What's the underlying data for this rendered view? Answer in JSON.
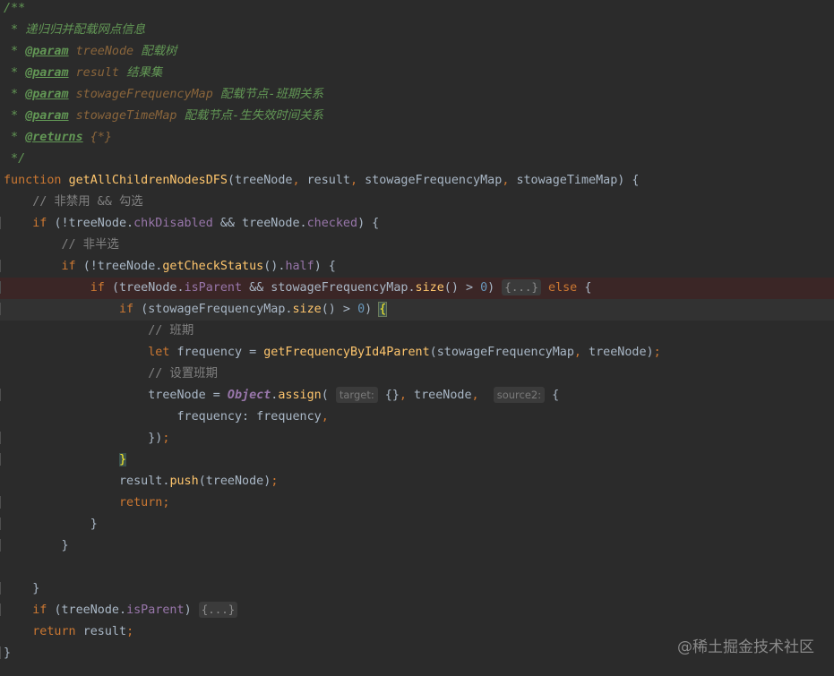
{
  "editor": {
    "lines": [
      {
        "segments": [
          {
            "t": "/**",
            "c": "doc"
          }
        ]
      },
      {
        "segments": [
          {
            "t": " * 递归归并配载网点信息",
            "c": "doc"
          }
        ]
      },
      {
        "segments": [
          {
            "t": " * ",
            "c": "doc"
          },
          {
            "t": "@param",
            "c": "doc-tag"
          },
          {
            "t": " treeNode ",
            "c": "doc-val"
          },
          {
            "t": "配载树",
            "c": "doc"
          }
        ]
      },
      {
        "segments": [
          {
            "t": " * ",
            "c": "doc"
          },
          {
            "t": "@param",
            "c": "doc-tag"
          },
          {
            "t": " result ",
            "c": "doc-val"
          },
          {
            "t": "结果集",
            "c": "doc"
          }
        ]
      },
      {
        "segments": [
          {
            "t": " * ",
            "c": "doc"
          },
          {
            "t": "@param",
            "c": "doc-tag"
          },
          {
            "t": " stowageFrequencyMap ",
            "c": "doc-val"
          },
          {
            "t": "配载节点-班期关系",
            "c": "doc"
          }
        ]
      },
      {
        "segments": [
          {
            "t": " * ",
            "c": "doc"
          },
          {
            "t": "@param",
            "c": "doc-tag"
          },
          {
            "t": " stowageTimeMap ",
            "c": "doc-val"
          },
          {
            "t": "配载节点-生失效时间关系",
            "c": "doc"
          }
        ]
      },
      {
        "segments": [
          {
            "t": " * ",
            "c": "doc"
          },
          {
            "t": "@returns",
            "c": "doc-tag"
          },
          {
            "t": " {*}",
            "c": "doc-val"
          }
        ]
      },
      {
        "segments": [
          {
            "t": " */",
            "c": "doc"
          }
        ]
      },
      {
        "segments": [
          {
            "t": "function ",
            "c": "kw"
          },
          {
            "t": "getAllChildrenNodesDFS",
            "c": "fn"
          },
          {
            "t": "(treeNode",
            "c": "plain"
          },
          {
            "t": ", ",
            "c": "kw"
          },
          {
            "t": "result",
            "c": "plain"
          },
          {
            "t": ", ",
            "c": "kw"
          },
          {
            "t": "stowageFrequencyMap",
            "c": "plain"
          },
          {
            "t": ", ",
            "c": "kw"
          },
          {
            "t": "stowageTimeMap) {",
            "c": "plain"
          }
        ]
      },
      {
        "segments": [
          {
            "t": "    // 非禁用 && 勾选",
            "c": "cmt"
          }
        ]
      },
      {
        "segments": [
          {
            "t": "    if ",
            "c": "kw"
          },
          {
            "t": "(!treeNode.",
            "c": "plain"
          },
          {
            "t": "chkDisabled",
            "c": "field"
          },
          {
            "t": " && treeNode.",
            "c": "plain"
          },
          {
            "t": "checked",
            "c": "field"
          },
          {
            "t": ") {",
            "c": "plain"
          }
        ]
      },
      {
        "segments": [
          {
            "t": "        // 非半选",
            "c": "cmt"
          }
        ]
      },
      {
        "segments": [
          {
            "t": "        if ",
            "c": "kw"
          },
          {
            "t": "(!treeNode.",
            "c": "plain"
          },
          {
            "t": "getCheckStatus",
            "c": "fn"
          },
          {
            "t": "().",
            "c": "plain"
          },
          {
            "t": "half",
            "c": "field"
          },
          {
            "t": ") {",
            "c": "plain"
          }
        ]
      },
      {
        "highlight": "error",
        "segments": [
          {
            "t": "            if ",
            "c": "kw"
          },
          {
            "t": "(treeNode.",
            "c": "plain"
          },
          {
            "t": "isParent",
            "c": "field"
          },
          {
            "t": " && stowageFrequencyMap.",
            "c": "plain"
          },
          {
            "t": "size",
            "c": "fn"
          },
          {
            "t": "() > ",
            "c": "plain"
          },
          {
            "t": "0",
            "c": "num"
          },
          {
            "t": ") ",
            "c": "plain"
          },
          {
            "t": "{...}",
            "c": "fold"
          },
          {
            "t": " else ",
            "c": "kw"
          },
          {
            "t": "{",
            "c": "plain"
          }
        ]
      },
      {
        "highlight": "caret",
        "segments": [
          {
            "t": "                if ",
            "c": "kw"
          },
          {
            "t": "(stowageFrequencyMap.",
            "c": "plain"
          },
          {
            "t": "size",
            "c": "fn"
          },
          {
            "t": "() > ",
            "c": "plain"
          },
          {
            "t": "0",
            "c": "num"
          },
          {
            "t": ") ",
            "c": "plain"
          },
          {
            "t": "{",
            "c": "brace-match"
          }
        ]
      },
      {
        "segments": [
          {
            "t": "                    // 班期",
            "c": "cmt"
          }
        ]
      },
      {
        "segments": [
          {
            "t": "                    let ",
            "c": "kw"
          },
          {
            "t": "frequency = ",
            "c": "plain"
          },
          {
            "t": "getFrequencyById4Parent",
            "c": "fn"
          },
          {
            "t": "(stowageFrequencyMap",
            "c": "plain"
          },
          {
            "t": ", ",
            "c": "kw"
          },
          {
            "t": "treeNode)",
            "c": "plain"
          },
          {
            "t": ";",
            "c": "kw"
          }
        ]
      },
      {
        "segments": [
          {
            "t": "                    // 设置班期",
            "c": "cmt"
          }
        ]
      },
      {
        "segments": [
          {
            "t": "                    treeNode = ",
            "c": "plain"
          },
          {
            "t": "Object",
            "c": "cls"
          },
          {
            "t": ".",
            "c": "plain"
          },
          {
            "t": "assign",
            "c": "fn"
          },
          {
            "t": "( ",
            "c": "plain"
          },
          {
            "t": "target:",
            "c": "hint"
          },
          {
            "t": " {}",
            "c": "plain"
          },
          {
            "t": ", ",
            "c": "kw"
          },
          {
            "t": "treeNode",
            "c": "plain"
          },
          {
            "t": ",  ",
            "c": "kw"
          },
          {
            "t": "source2:",
            "c": "hint"
          },
          {
            "t": " {",
            "c": "plain"
          }
        ]
      },
      {
        "segments": [
          {
            "t": "                        frequency: frequency",
            "c": "plain"
          },
          {
            "t": ",",
            "c": "kw"
          }
        ]
      },
      {
        "segments": [
          {
            "t": "                    })",
            "c": "plain"
          },
          {
            "t": ";",
            "c": "kw"
          }
        ]
      },
      {
        "segments": [
          {
            "t": "                ",
            "c": "plain"
          },
          {
            "t": "}",
            "c": "brace-match-y"
          }
        ]
      },
      {
        "segments": [
          {
            "t": "                result.",
            "c": "plain"
          },
          {
            "t": "push",
            "c": "fn"
          },
          {
            "t": "(treeNode)",
            "c": "plain"
          },
          {
            "t": ";",
            "c": "kw"
          }
        ]
      },
      {
        "segments": [
          {
            "t": "                return",
            "c": "kw"
          },
          {
            "t": ";",
            "c": "kw"
          }
        ]
      },
      {
        "segments": [
          {
            "t": "            }",
            "c": "plain"
          }
        ]
      },
      {
        "segments": [
          {
            "t": "        }",
            "c": "plain"
          }
        ]
      },
      {
        "segments": []
      },
      {
        "segments": [
          {
            "t": "    }",
            "c": "plain"
          }
        ]
      },
      {
        "segments": [
          {
            "t": "    if ",
            "c": "kw"
          },
          {
            "t": "(treeNode.",
            "c": "plain"
          },
          {
            "t": "isParent",
            "c": "field"
          },
          {
            "t": ") ",
            "c": "plain"
          },
          {
            "t": "{...}",
            "c": "fold"
          }
        ]
      },
      {
        "segments": [
          {
            "t": "    return ",
            "c": "kw"
          },
          {
            "t": "result",
            "c": "plain"
          },
          {
            "t": ";",
            "c": "kw"
          }
        ]
      },
      {
        "segments": [
          {
            "t": "}",
            "c": "plain"
          }
        ]
      }
    ]
  },
  "watermark": "@稀土掘金技术社区",
  "colors": {
    "background": "#2b2b2b",
    "keyword": "#cc7832",
    "function": "#ffc66d",
    "field": "#9876aa",
    "number": "#6897bb",
    "comment": "#808080",
    "doc_comment": "#629755"
  }
}
